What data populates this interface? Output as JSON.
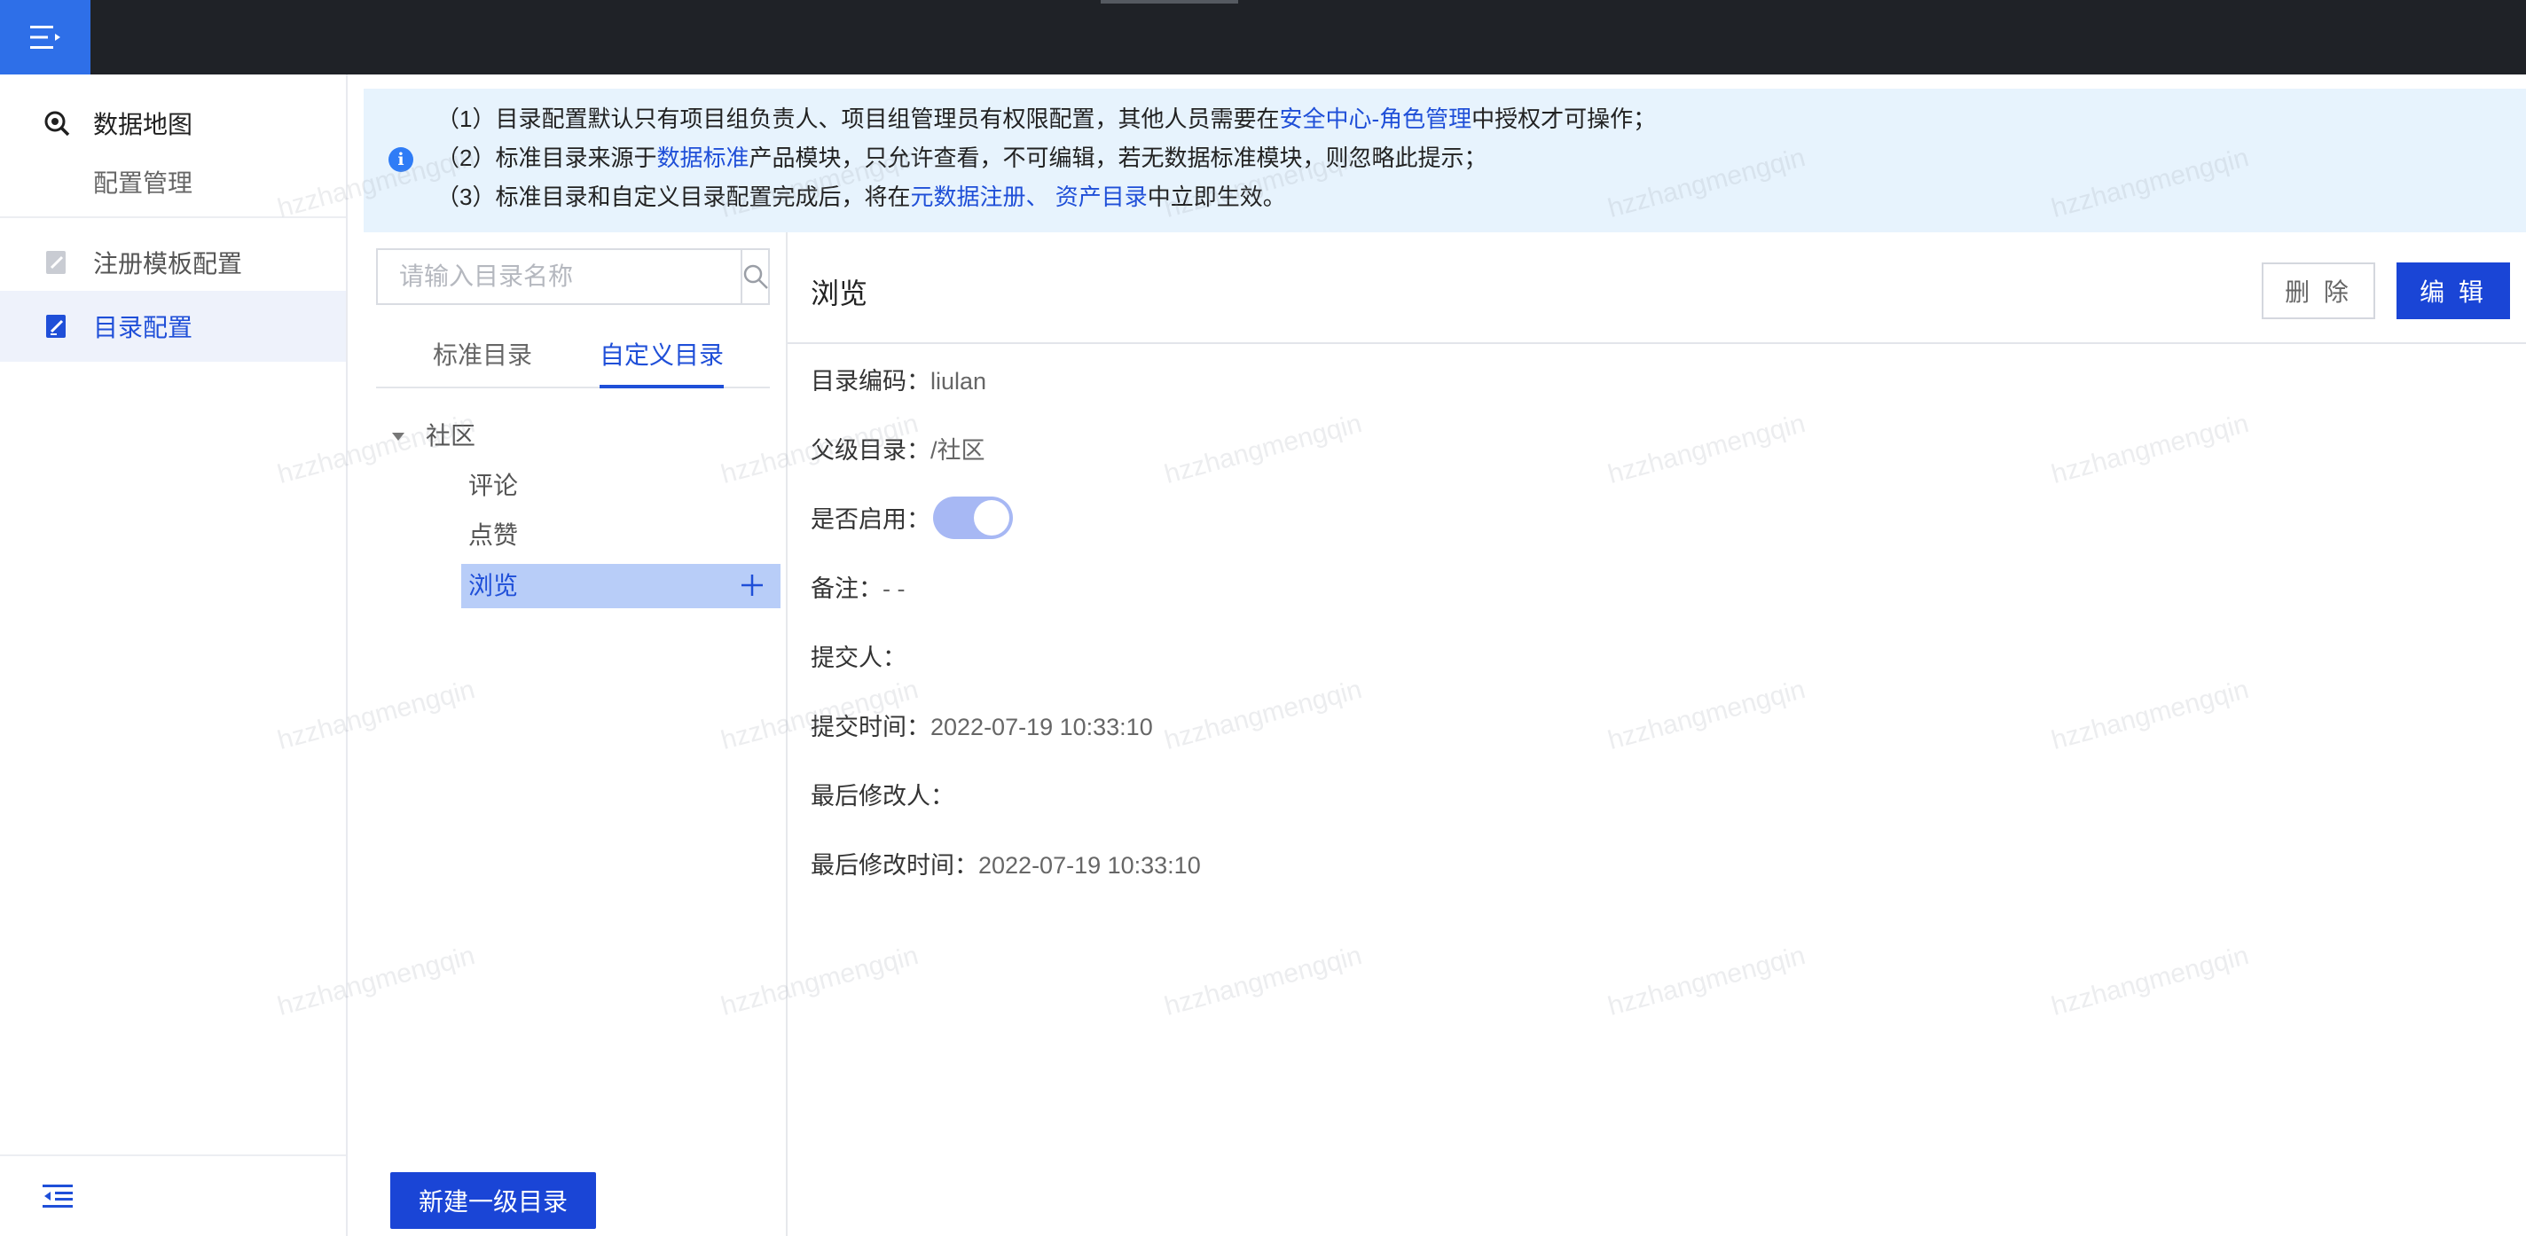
{
  "sidebar": {
    "root_label": "数据地图",
    "sub_label": "配置管理",
    "items": [
      {
        "label": "注册模板配置"
      },
      {
        "label": "目录配置"
      }
    ]
  },
  "banner": {
    "line1_prefix": "（1）目录配置默认只有项目组负责人、项目组管理员有权限配置，其他人员需要在",
    "line1_link": "安全中心-角色管理",
    "line1_suffix": "中授权才可操作；",
    "line2_prefix": "（2）标准目录来源于",
    "line2_link": "数据标准",
    "line2_suffix": "产品模块，只允许查看，不可编辑，若无数据标准模块，则忽略此提示；",
    "line3_prefix": "（3）标准目录和自定义目录配置完成后，将在",
    "line3_link": "元数据注册、 资产目录",
    "line3_suffix": "中立即生效。"
  },
  "tree": {
    "search_placeholder": "请输入目录名称",
    "tabs": [
      "标准目录",
      "自定义目录"
    ],
    "active_tab": "自定义目录",
    "root": "社区",
    "children": [
      "评论",
      "点赞",
      "浏览"
    ],
    "selected": "浏览",
    "new_button": "新建一级目录"
  },
  "detail": {
    "title": "浏览",
    "delete_label": "删 除",
    "edit_label": "编 辑",
    "fields": [
      {
        "key": "目录编码：",
        "value": "liulan"
      },
      {
        "key": "父级目录：",
        "value": "/社区"
      },
      {
        "key": "是否启用：",
        "value": ""
      },
      {
        "key": "备注：",
        "value": "- -"
      },
      {
        "key": "提交人：",
        "value": ""
      },
      {
        "key": "提交时间：",
        "value": "2022-07-19 10:33:10"
      },
      {
        "key": "最后修改人：",
        "value": ""
      },
      {
        "key": "最后修改时间：",
        "value": "2022-07-19 10:33:10"
      }
    ],
    "enabled": true
  },
  "watermark": "hzzhangmengqin",
  "colors": {
    "accent": "#1a45d6",
    "topbar": "#1f2227",
    "banner_bg": "#e7f3fd",
    "selected_bg": "#b8cdf8"
  }
}
